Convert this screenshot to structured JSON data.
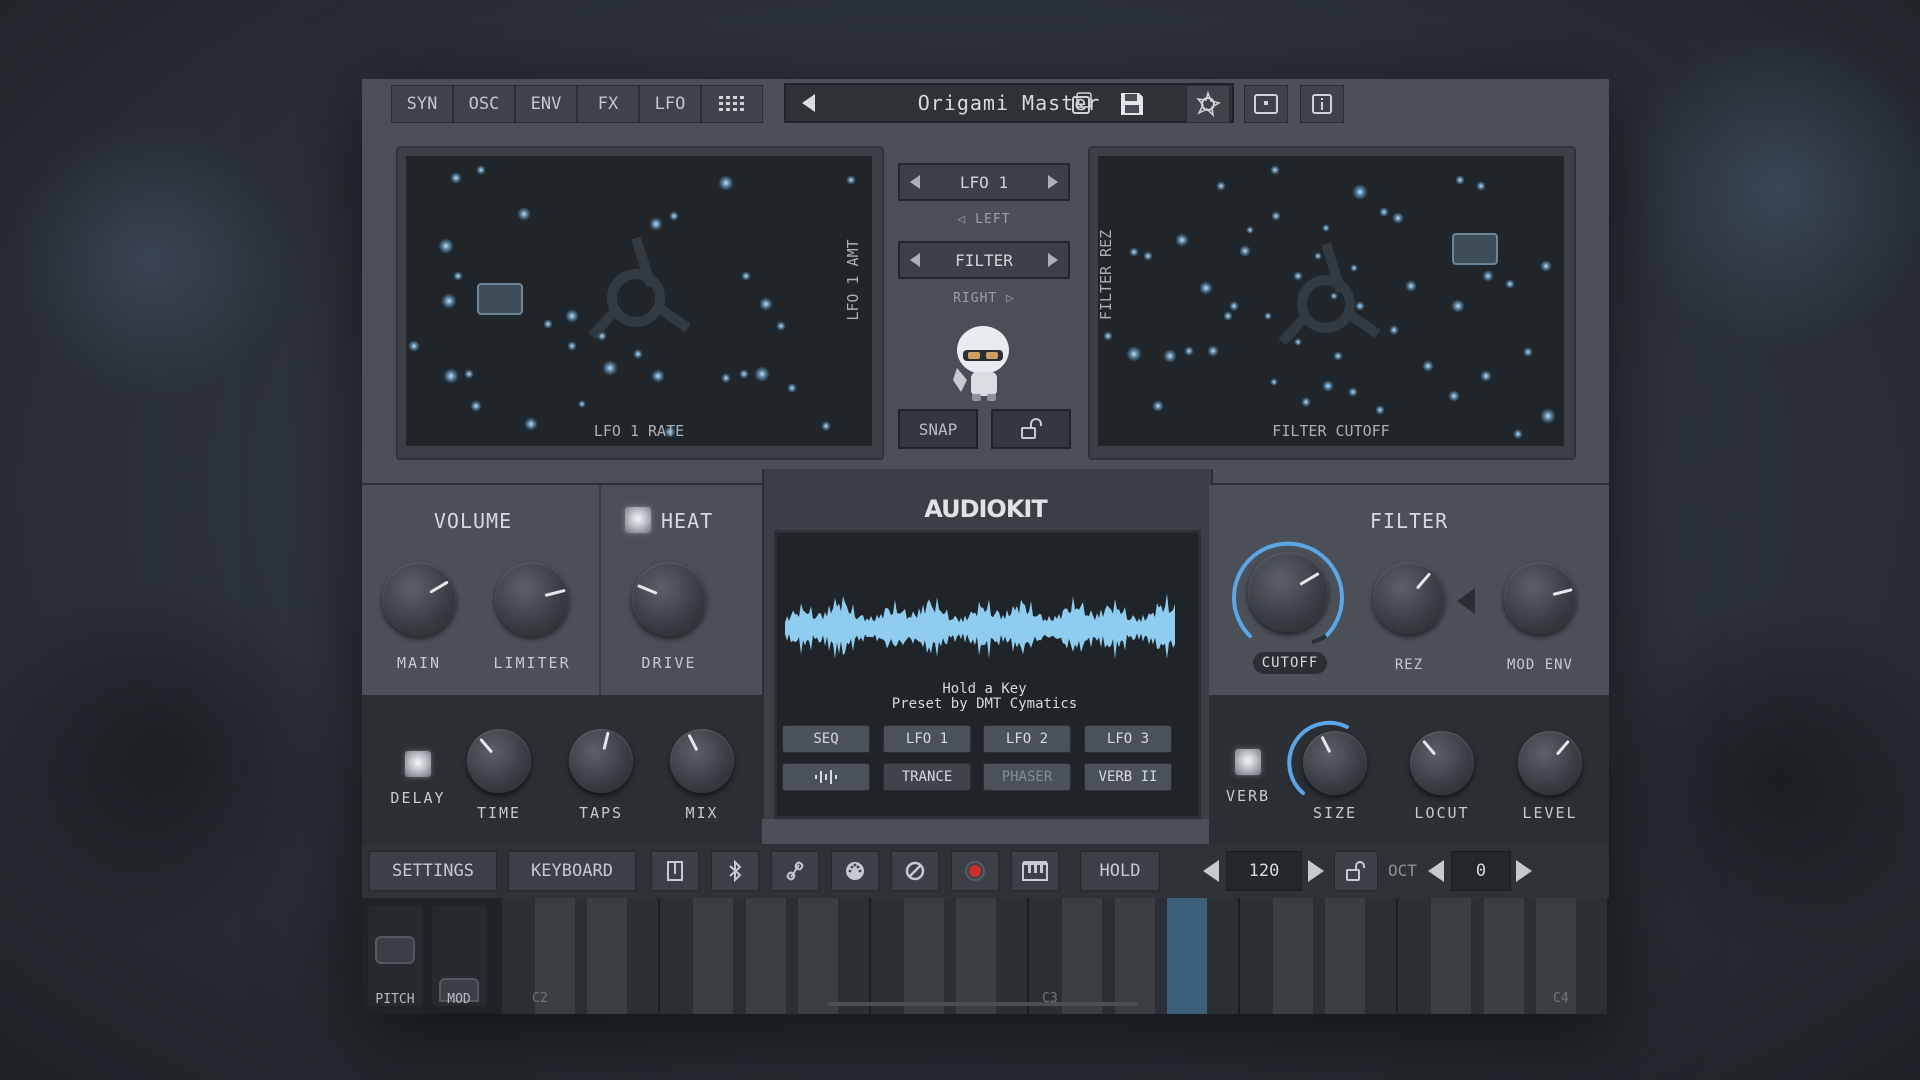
{
  "app": {
    "tabs": [
      {
        "label": "SYN"
      },
      {
        "label": "OSC"
      },
      {
        "label": "ENV"
      },
      {
        "label": "FX"
      },
      {
        "label": "LFO"
      }
    ],
    "preset_name": "Origami Master",
    "icons": {
      "grid": "grid-icon",
      "dice": "dice-icon",
      "save": "save-icon",
      "logo": "audiokit-logo-icon",
      "window": "window-icon",
      "info": "info-icon"
    }
  },
  "xy_left": {
    "y_label": "LFO 1 AMT",
    "x_label": "LFO 1 RATE"
  },
  "xy_right": {
    "y_label": "FILTER REZ",
    "x_label": "FILTER CUTOFF"
  },
  "mid": {
    "left_target": "LFO 1",
    "left_caption": "◁ LEFT",
    "right_target": "FILTER",
    "right_caption": "RIGHT ▷",
    "snap_label": "SNAP",
    "lock_icon": "unlock-icon"
  },
  "volume": {
    "title": "VOLUME",
    "knobs": [
      {
        "label": "MAIN",
        "value": 0.72
      },
      {
        "label": "LIMITER",
        "value": 0.78
      }
    ]
  },
  "heat": {
    "title": "HEAT",
    "knob": {
      "label": "DRIVE",
      "value": 0.25
    }
  },
  "center": {
    "brand": "AUDIOKIT",
    "hint": "Hold a Key",
    "credit": "Preset by DMT Cymatics",
    "fx_row1": [
      "SEQ",
      "LFO 1",
      "LFO 2",
      "LFO 3"
    ],
    "fx_row2": [
      "",
      "TRANCE",
      "PHASER",
      "VERB II"
    ]
  },
  "filter": {
    "title": "FILTER",
    "knobs": [
      {
        "label": "CUTOFF",
        "value": 0.72
      },
      {
        "label": "REZ",
        "value": 0.65
      },
      {
        "label": "MOD ENV",
        "value": 0.78
      }
    ]
  },
  "delay": {
    "label": "DELAY",
    "knobs": [
      {
        "label": "TIME",
        "value": 0.35
      },
      {
        "label": "TAPS",
        "value": 0.55
      },
      {
        "label": "MIX",
        "value": 0.4
      }
    ]
  },
  "reverb": {
    "label": "VERB",
    "knobs": [
      {
        "label": "SIZE",
        "value": 0.4
      },
      {
        "label": "LOCUT",
        "value": 0.35
      },
      {
        "label": "LEVEL",
        "value": 0.65
      }
    ]
  },
  "bottombar": {
    "settings": "SETTINGS",
    "keyboard": "KEYBOARD",
    "hold": "HOLD",
    "tempo": "120",
    "oct_label": "OCT",
    "oct_value": "0",
    "record_color": "#c9302c"
  },
  "keyboard": {
    "labels": [
      "C2",
      "C3",
      "C4"
    ],
    "pitch_label": "PITCH",
    "mod_label": "MOD",
    "pressed_color": "#3b5f7a"
  },
  "colors": {
    "accent": "#5aa6e6",
    "wave": "#8ecdf0"
  }
}
